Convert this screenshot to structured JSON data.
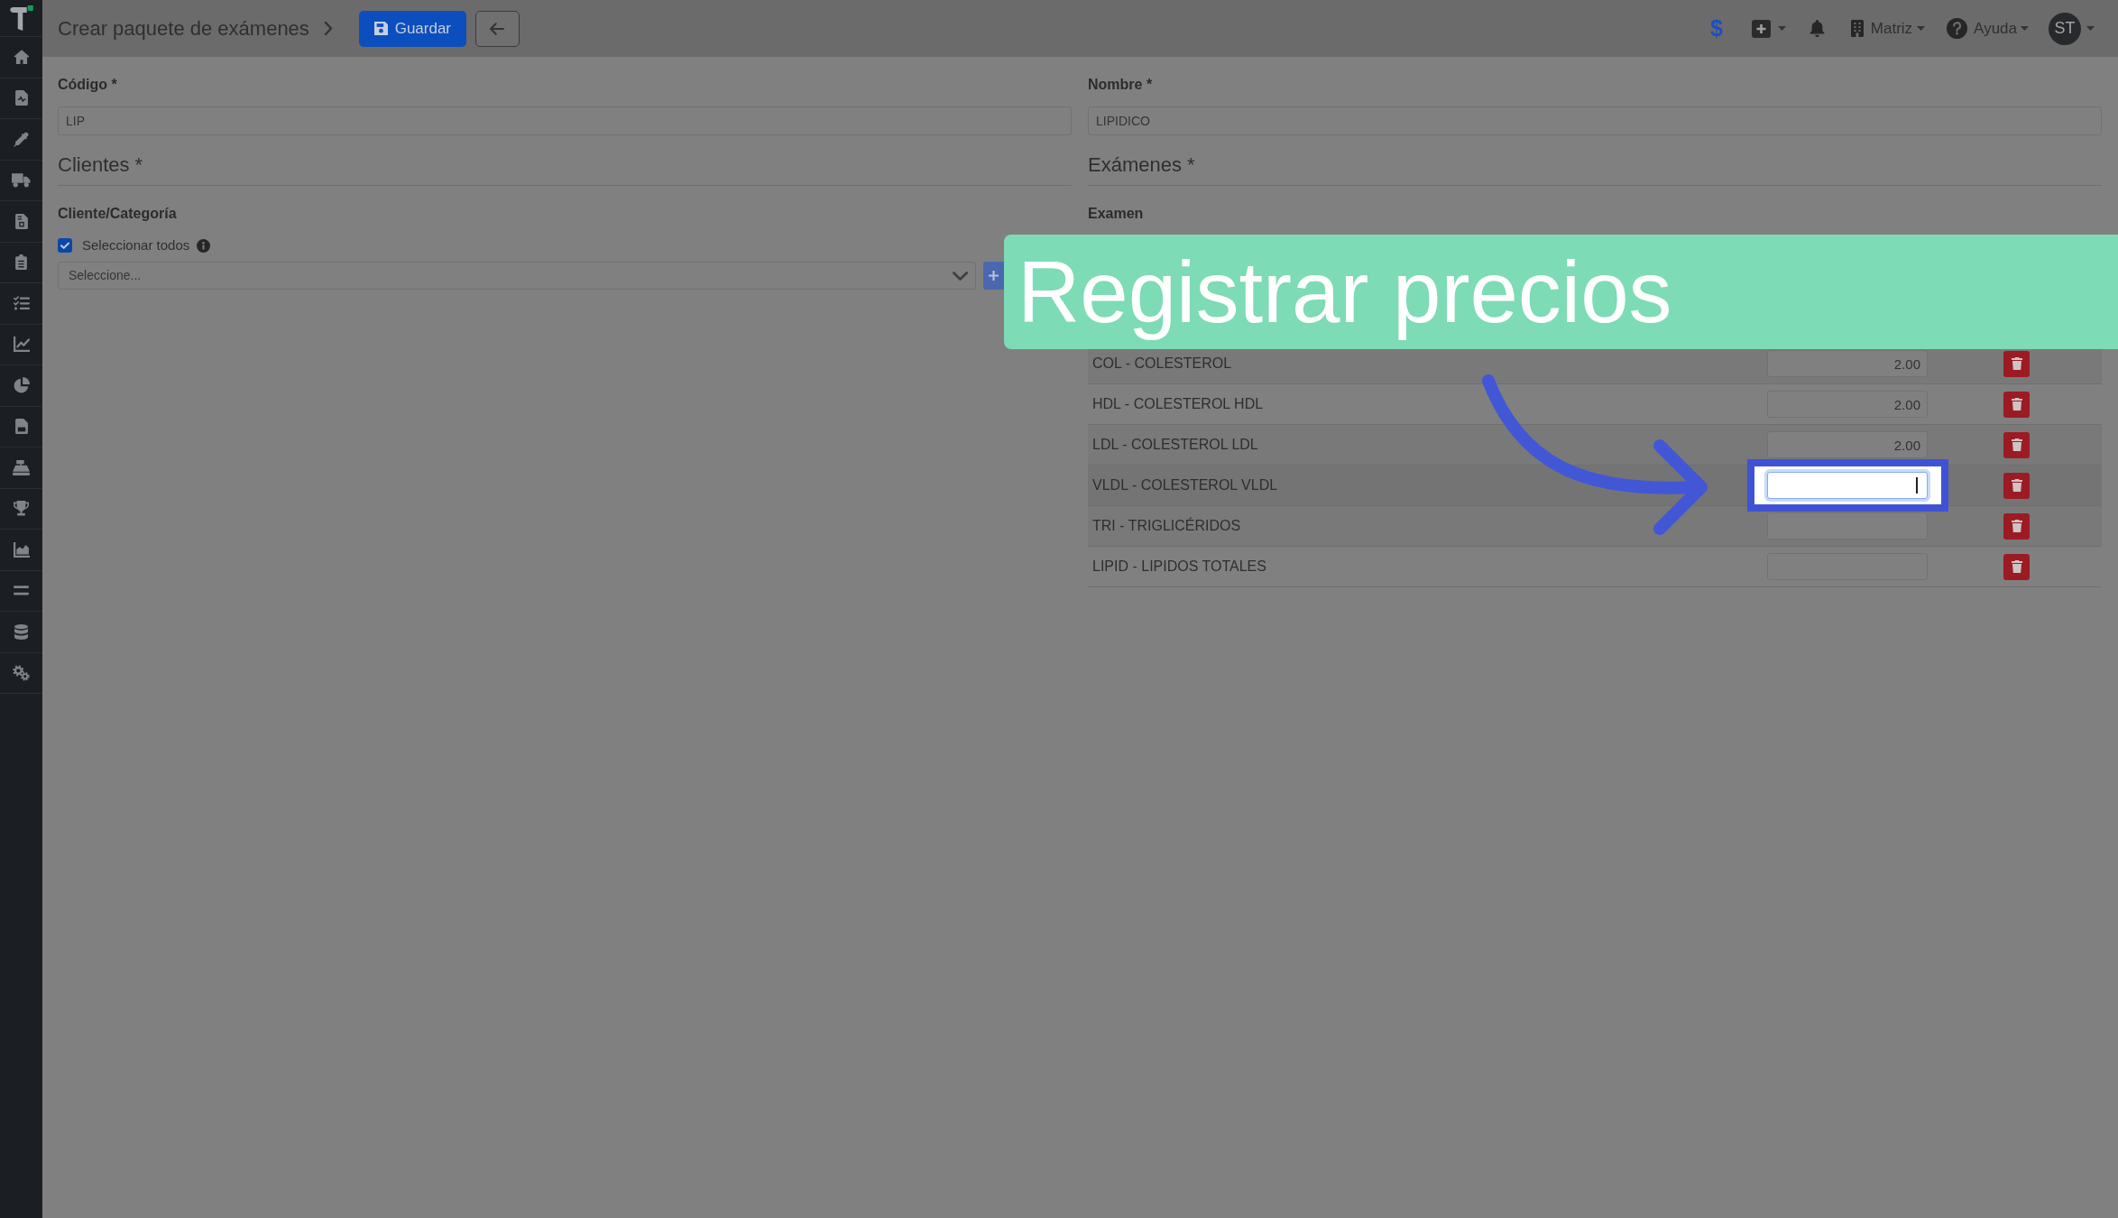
{
  "header": {
    "title": "Crear paquete de exámenes",
    "save_button": "Guardar",
    "currency_icon": "$",
    "branch_menu": "Matriz",
    "help_menu": "Ayuda",
    "avatar": "ST"
  },
  "fields": [
    {
      "label": "Código *",
      "value": "LIP"
    },
    {
      "label": "Nombre *",
      "value": "LIPIDICO"
    }
  ],
  "clients": {
    "heading": "Clientes *",
    "label": "Cliente/Categoría",
    "select_all": {
      "label": "Seleccionar todos",
      "checked": true
    },
    "select": {
      "placeholder": "Seleccione..."
    }
  },
  "exams": {
    "heading": "Exámenes *",
    "label": "Examen",
    "rows": [
      {
        "name": "COL - COLESTEROL",
        "price": "2.00",
        "focused": false
      },
      {
        "name": "HDL - COLESTEROL HDL",
        "price": "2.00",
        "focused": false
      },
      {
        "name": "LDL - COLESTEROL LDL",
        "price": "2.00",
        "focused": false
      },
      {
        "name": "VLDL - COLESTEROL VLDL",
        "focused": true
      },
      {
        "name": "TRI - TRIGLICÉRIDOS",
        "focused": false
      },
      {
        "name": "LIPID - LIPIDOS TOTALES",
        "focused": false
      }
    ]
  },
  "tour": {
    "banner": "Registrar precios"
  }
}
